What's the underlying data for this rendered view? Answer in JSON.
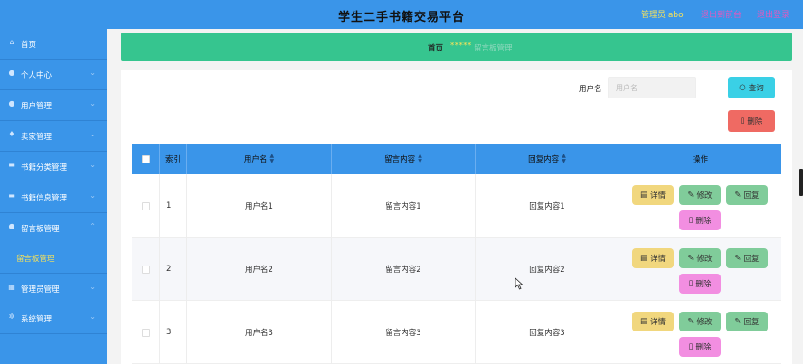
{
  "header": {
    "title": "学生二手书籍交易平台",
    "admin_label": "管理员 abo",
    "link_back": "退出到前台",
    "link_logout": "退出登录"
  },
  "sidebar": {
    "items": [
      {
        "label": "首页",
        "icon": "home-icon"
      },
      {
        "label": "个人中心",
        "icon": "user-icon"
      },
      {
        "label": "用户管理",
        "icon": "user-icon"
      },
      {
        "label": "卖家管理",
        "icon": "mic-icon"
      },
      {
        "label": "书籍分类管理",
        "icon": "book-icon"
      },
      {
        "label": "书籍信息管理",
        "icon": "book-icon"
      },
      {
        "label": "留言板管理",
        "icon": "user-icon"
      },
      {
        "label": "管理员管理",
        "icon": "grid-icon"
      },
      {
        "label": "系统管理",
        "icon": "gear-icon"
      }
    ],
    "sub_item": "留言板管理"
  },
  "breadcrumb": {
    "home": "首页",
    "separator": "*****",
    "current": "留言板管理"
  },
  "search": {
    "label": "用户名",
    "placeholder": "用户名",
    "query_button": "查询",
    "delete_button": "删除"
  },
  "table": {
    "columns": [
      "索引",
      "用户名",
      "留言内容",
      "回复内容",
      "操作"
    ],
    "rows": [
      {
        "index": "1",
        "username": "用户名1",
        "message": "留言内容1",
        "reply": "回复内容1"
      },
      {
        "index": "2",
        "username": "用户名2",
        "message": "留言内容2",
        "reply": "回复内容2"
      },
      {
        "index": "3",
        "username": "用户名3",
        "message": "留言内容3",
        "reply": "回复内容3"
      }
    ],
    "actions": {
      "detail": "详情",
      "edit": "修改",
      "reply": "回复",
      "delete": "删除"
    }
  },
  "colors": {
    "primary": "#3a95e9",
    "breadcrumb": "#36c58f",
    "accent_yellow": "#f7e25a",
    "query": "#3ad0e6",
    "danger": "#ef6a63"
  }
}
